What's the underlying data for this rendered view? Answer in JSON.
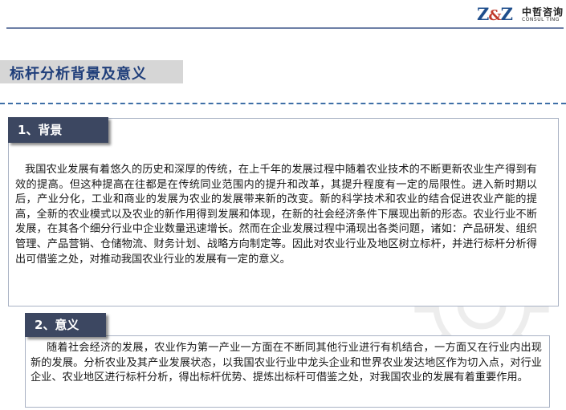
{
  "brand": {
    "logo_mark": "Z&Z",
    "name_cn": "中哲咨询",
    "name_en": "CONSUL TING"
  },
  "page": {
    "title": "标杆分析背景及意义"
  },
  "sections": [
    {
      "heading": "1、背景",
      "body": "我国农业发展有着悠久的历史和深厚的传统，在上千年的发展过程中随着农业技术的不断更新农业生产得到有效的提高。但这种提高在往都是在传统同业范围内的提升和改革，其提升程度有一定的局限性。进入新时期以后，产业分化，工业和商业的发展为农业的发展带来新的改变。新的科学技术和农业的结合促进农业产能的提高，全新的农业模式以及农业的新作用得到发展和体现，在新的社会经济条件下展现出新的形态。农业行业不断发展，在其各个细分行业中企业数量迅速增长。然而在企业发展过程中涌现出各类问题，诸如：产品研发、组织管理、产品营销、仓储物流、财务计划、战略方向制定等。因此对农业行业及地区树立标杆，并进行标杆分析得出可借鉴之处，对推动我国农业行业的发展有一定的意义。"
    },
    {
      "heading": "2、意义",
      "body": "随着社会经济的发展，农业作为第一产业一方面在不断同其他行业进行有机结合，一方面又在行业内出现新的发展。分析农业及其产业发展状态，以我国农业行业中龙头企业和世界农业发达地区作为切入点，对行业企业、农业地区进行标杆分析，得出标杆优势、提炼出标杆可借鉴之处，对我国农业的发展有着重要作用。"
    }
  ],
  "colors": {
    "heading_bar": "#3c4761",
    "title_text": "#1f3e7a",
    "title_band": "#d6d6d6",
    "dashed_rule": "#3e6fa7"
  },
  "icons": {
    "watermark": "gear-icon"
  }
}
